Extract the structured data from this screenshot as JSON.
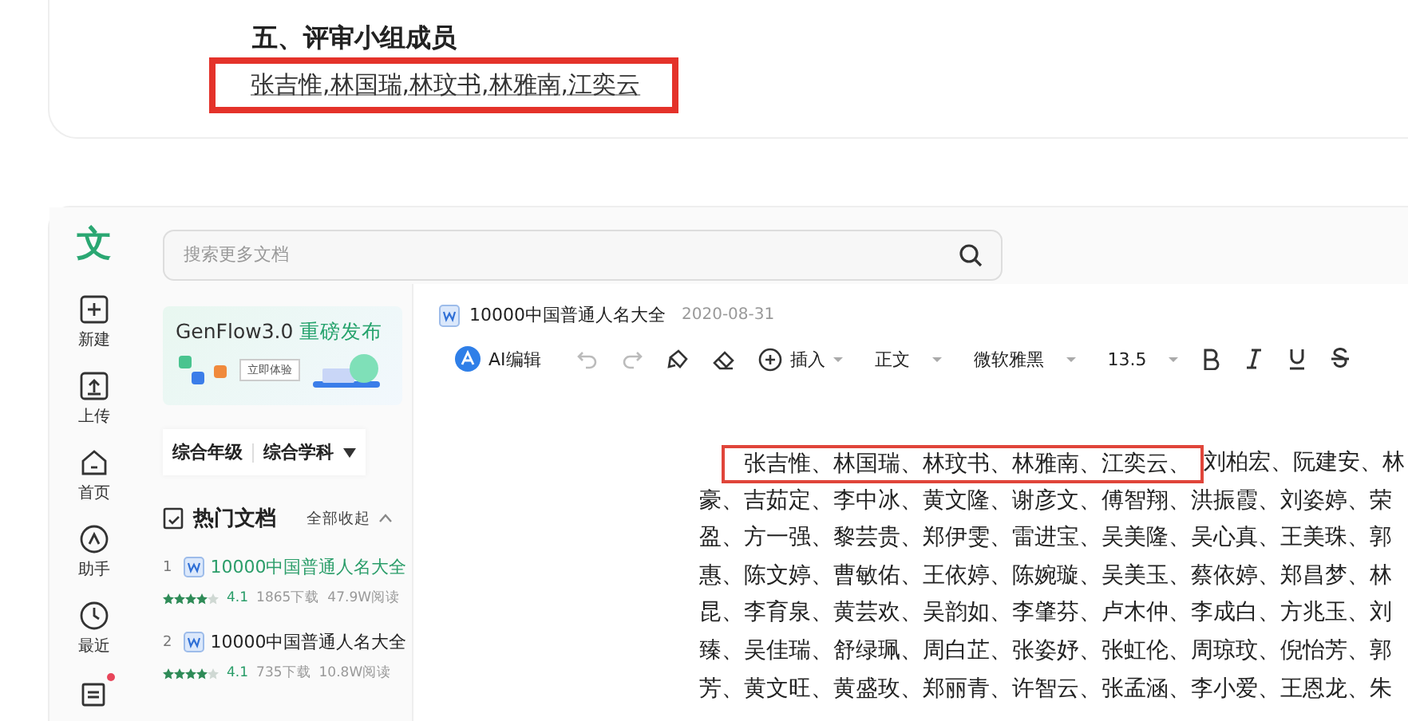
{
  "top_card": {
    "heading": "五、评审小组成员",
    "highlighted_text": "张吉惟,林国瑞,林玟书,林雅南,江奕云"
  },
  "app": {
    "logo": "文",
    "rail": [
      {
        "kind": "new",
        "label": "新建",
        "badge": false
      },
      {
        "kind": "upload",
        "label": "上传",
        "badge": false
      },
      {
        "kind": "home",
        "label": "首页",
        "badge": false
      },
      {
        "kind": "assistant",
        "label": "助手",
        "badge": false
      },
      {
        "kind": "recent",
        "label": "最近",
        "badge": false
      },
      {
        "kind": "list",
        "badge": true
      }
    ],
    "search": {
      "placeholder": "搜索更多文档"
    },
    "banner": {
      "title": "GenFlow3.0",
      "highlight": "重磅发布",
      "button": "立即体验"
    },
    "filters": [
      "综合年级",
      "综合学科"
    ],
    "hot_docs": {
      "title": "热门文档",
      "toggle": "全部收起",
      "items": [
        {
          "rank": "1",
          "title": "10000中国普通人名大全",
          "selected": true,
          "stars": 4,
          "rating": "4.1",
          "downloads": "1865下载",
          "reads": "47.9W阅读"
        },
        {
          "rank": "2",
          "title": "10000中国普通人名大全",
          "selected": false,
          "stars": 4,
          "rating": "4.1",
          "downloads": "735下载",
          "reads": "10.8W阅读"
        }
      ]
    },
    "document": {
      "title": "10000中国普通人名大全",
      "date": "2020-08-31",
      "toolbar": {
        "ai": "AI编辑",
        "insert": "插入",
        "style": "正文",
        "font": "微软雅黑",
        "size": "13.5"
      },
      "highlight": "张吉惟、林国瑞、林玟书、林雅南、江奕云、",
      "lines": [
        "刘柏宏、阮建安、林",
        "豪、吉茹定、李中冰、黄文隆、谢彦文、傅智翔、洪振霞、刘姿婷、荣",
        "盈、方一强、黎芸贵、郑伊雯、雷进宝、吴美隆、吴心真、王美珠、郭",
        "惠、陈文婷、曹敏佑、王依婷、陈婉璇、吴美玉、蔡依婷、郑昌梦、林",
        "昆、李育泉、黄芸欢、吴韵如、李肇芬、卢木仲、李成白、方兆玉、刘",
        "臻、吴佳瑞、舒绿珮、周白芷、张姿妤、张虹伦、周琼玟、倪怡芳、郭",
        "芳、黄文旺、黄盛玫、郑丽青、许智云、张孟涵、李小爱、王恩龙、朱"
      ]
    }
  }
}
